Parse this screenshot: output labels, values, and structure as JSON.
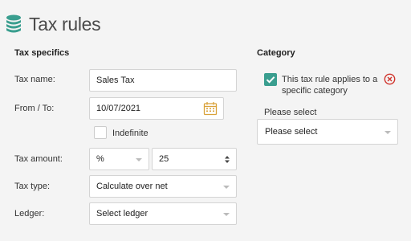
{
  "header": {
    "title": "Tax rules",
    "icon": "coins-stack-icon"
  },
  "tax_specifics": {
    "section_title": "Tax specifics",
    "tax_name": {
      "label": "Tax name:",
      "value": "Sales Tax"
    },
    "from_to": {
      "label": "From / To:",
      "value": "10/07/2021",
      "icon": "calendar-icon"
    },
    "indefinite": {
      "label": "Indefinite",
      "checked": false
    },
    "tax_amount": {
      "label": "Tax amount:",
      "unit": "%",
      "value": "25"
    },
    "tax_type": {
      "label": "Tax type:",
      "value": "Calculate over net"
    },
    "ledger": {
      "label": "Ledger:",
      "value": "Select ledger"
    }
  },
  "category": {
    "section_title": "Category",
    "applies_checkbox": {
      "label": "This tax rule applies to a specific category",
      "checked": true
    },
    "remove_icon": "remove-circle-icon",
    "select_label": "Please select",
    "select_value": "Please select"
  },
  "colors": {
    "accent": "#3a9e8f",
    "remove": "#d0342c"
  }
}
